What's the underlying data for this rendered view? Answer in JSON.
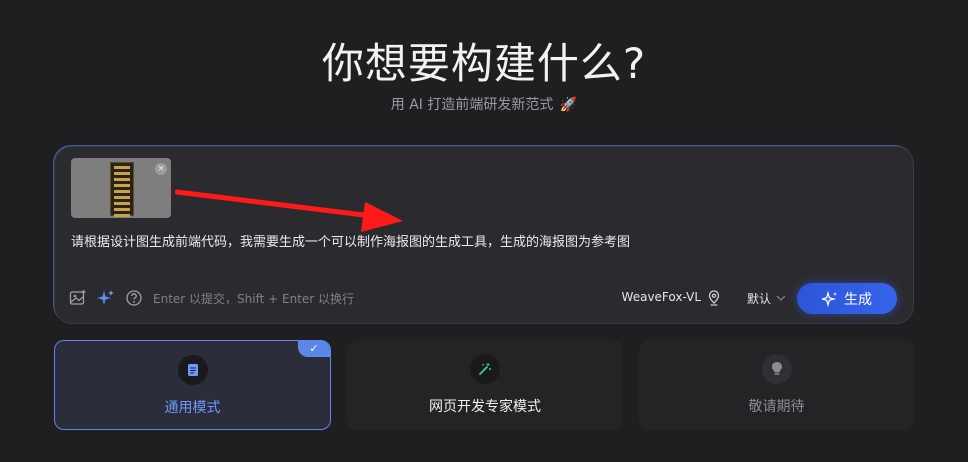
{
  "header": {
    "title": "你想要构建什么?",
    "subtitle": "用 AI 打造前端研发新范式",
    "subtitle_emoji": "🚀"
  },
  "composer": {
    "attachment": {
      "close_glyph": "×"
    },
    "prompt": "请根据设计图生成前端代码，我需要生成一个可以制作海报图的生成工具，生成的海报图为参考图",
    "hint": "Enter 以提交，Shift + Enter 以换行",
    "model": "WeaveFox-VL",
    "mode": "默认",
    "generate_label": "生成"
  },
  "modes": [
    {
      "label": "通用模式",
      "selected": true,
      "icon": "document-icon"
    },
    {
      "label": "网页开发专家模式",
      "selected": false,
      "icon": "magic-wand-icon"
    },
    {
      "label": "敬请期待",
      "selected": false,
      "icon": "lightbulb-icon"
    }
  ],
  "colors": {
    "accent": "#3564ea",
    "selected_border": "#5b87e8",
    "annotation_arrow": "#ff1a1a"
  }
}
